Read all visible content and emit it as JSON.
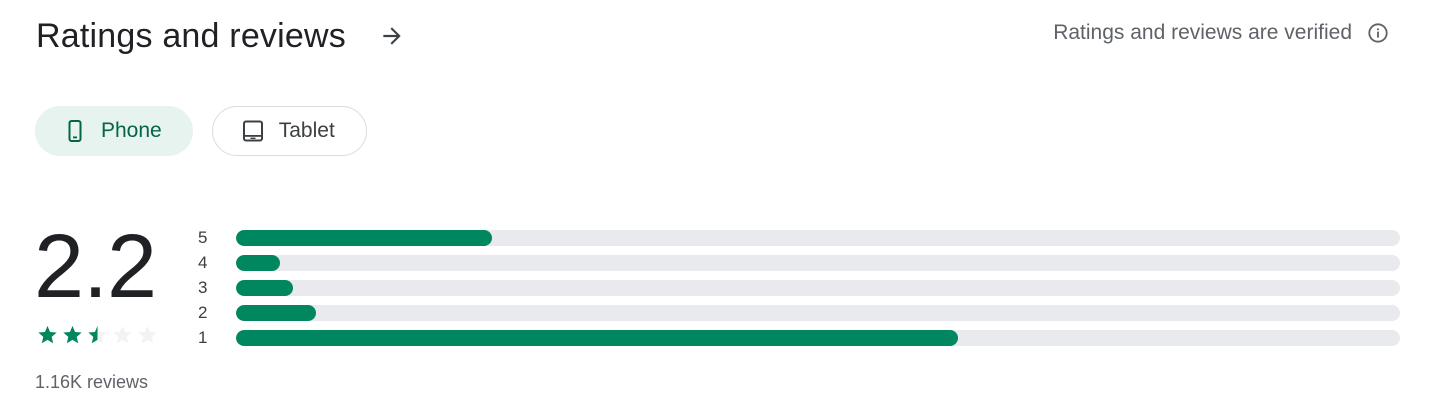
{
  "header": {
    "title": "Ratings and reviews",
    "arrow_icon": "arrow-right-icon",
    "verified_text": "Ratings and reviews are verified",
    "info_icon": "info-icon"
  },
  "device_tabs": [
    {
      "label": "Phone",
      "icon": "phone-icon",
      "selected": true
    },
    {
      "label": "Tablet",
      "icon": "tablet-icon",
      "selected": false
    }
  ],
  "summary": {
    "score": "2.2",
    "stars_filled": 2.5,
    "stars_total": 5,
    "review_count": "1.16K reviews"
  },
  "distribution": [
    {
      "stars": "5",
      "fraction": 0.22
    },
    {
      "stars": "4",
      "fraction": 0.038
    },
    {
      "stars": "3",
      "fraction": 0.049
    },
    {
      "stars": "2",
      "fraction": 0.069
    },
    {
      "stars": "1",
      "fraction": 0.62
    }
  ],
  "colors": {
    "accent": "#01875f",
    "chip_active_bg": "#e6f3ef",
    "chip_active_text": "#056449",
    "track": "#e8eaed",
    "star_empty": "#f1f3f4"
  }
}
